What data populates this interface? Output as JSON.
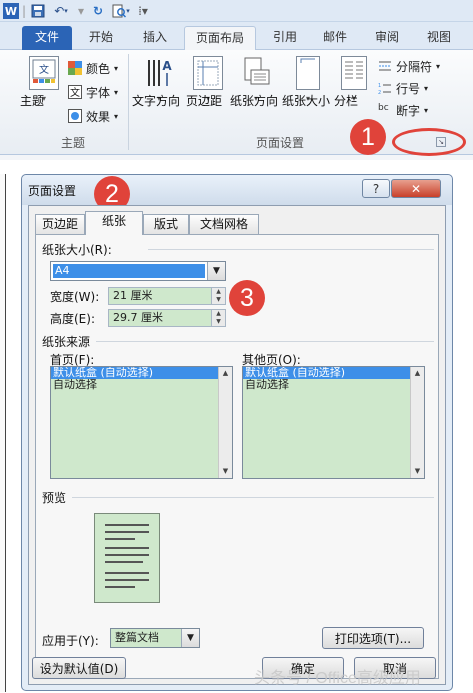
{
  "ribbon": {
    "tabs": [
      "文件",
      "开始",
      "插入",
      "页面布局",
      "引用",
      "邮件",
      "审阅",
      "视图"
    ],
    "active_tab": "页面布局",
    "theme_group": {
      "label": "主题",
      "theme_button": "主题",
      "colors": "颜色",
      "fonts": "字体",
      "effects": "效果"
    },
    "page_setup_group": {
      "label": "页面设置",
      "text_direction": "文字方向",
      "margins": "页边距",
      "orientation": "纸张方向",
      "size": "纸张大小",
      "columns": "分栏",
      "breaks": "分隔符",
      "line_numbers": "行号",
      "hyphenation": "断字"
    }
  },
  "callouts": [
    "1",
    "2",
    "3"
  ],
  "dialog": {
    "title": "页面设置",
    "help": "?",
    "close": "✕",
    "tabs": [
      "页边距",
      "纸张",
      "版式",
      "文档网格"
    ],
    "active_tab": "纸张",
    "paper_size_label": "纸张大小(R):",
    "paper_size_value": "A4",
    "width_label": "宽度(W):",
    "width_value": "21 厘米",
    "height_label": "高度(E):",
    "height_value": "29.7 厘米",
    "paper_source_label": "纸张来源",
    "first_page_label": "首页(F):",
    "other_pages_label": "其他页(O):",
    "first_page_items": [
      "默认纸盒 (自动选择)",
      "自动选择"
    ],
    "other_pages_items": [
      "默认纸盒 (自动选择)",
      "自动选择"
    ],
    "preview_label": "预览",
    "apply_to_label": "应用于(Y):",
    "apply_to_value": "整篇文档",
    "print_options": "打印选项(T)...",
    "set_default": "设为默认值(D)",
    "ok": "确定",
    "cancel": "取消"
  },
  "watermark": "头条号 / Office高级应用",
  "colors": {
    "accent": "#2b64b6",
    "callout": "#e0433a",
    "selection": "#3d8fe8",
    "field_bg": "#cfe8cc"
  }
}
